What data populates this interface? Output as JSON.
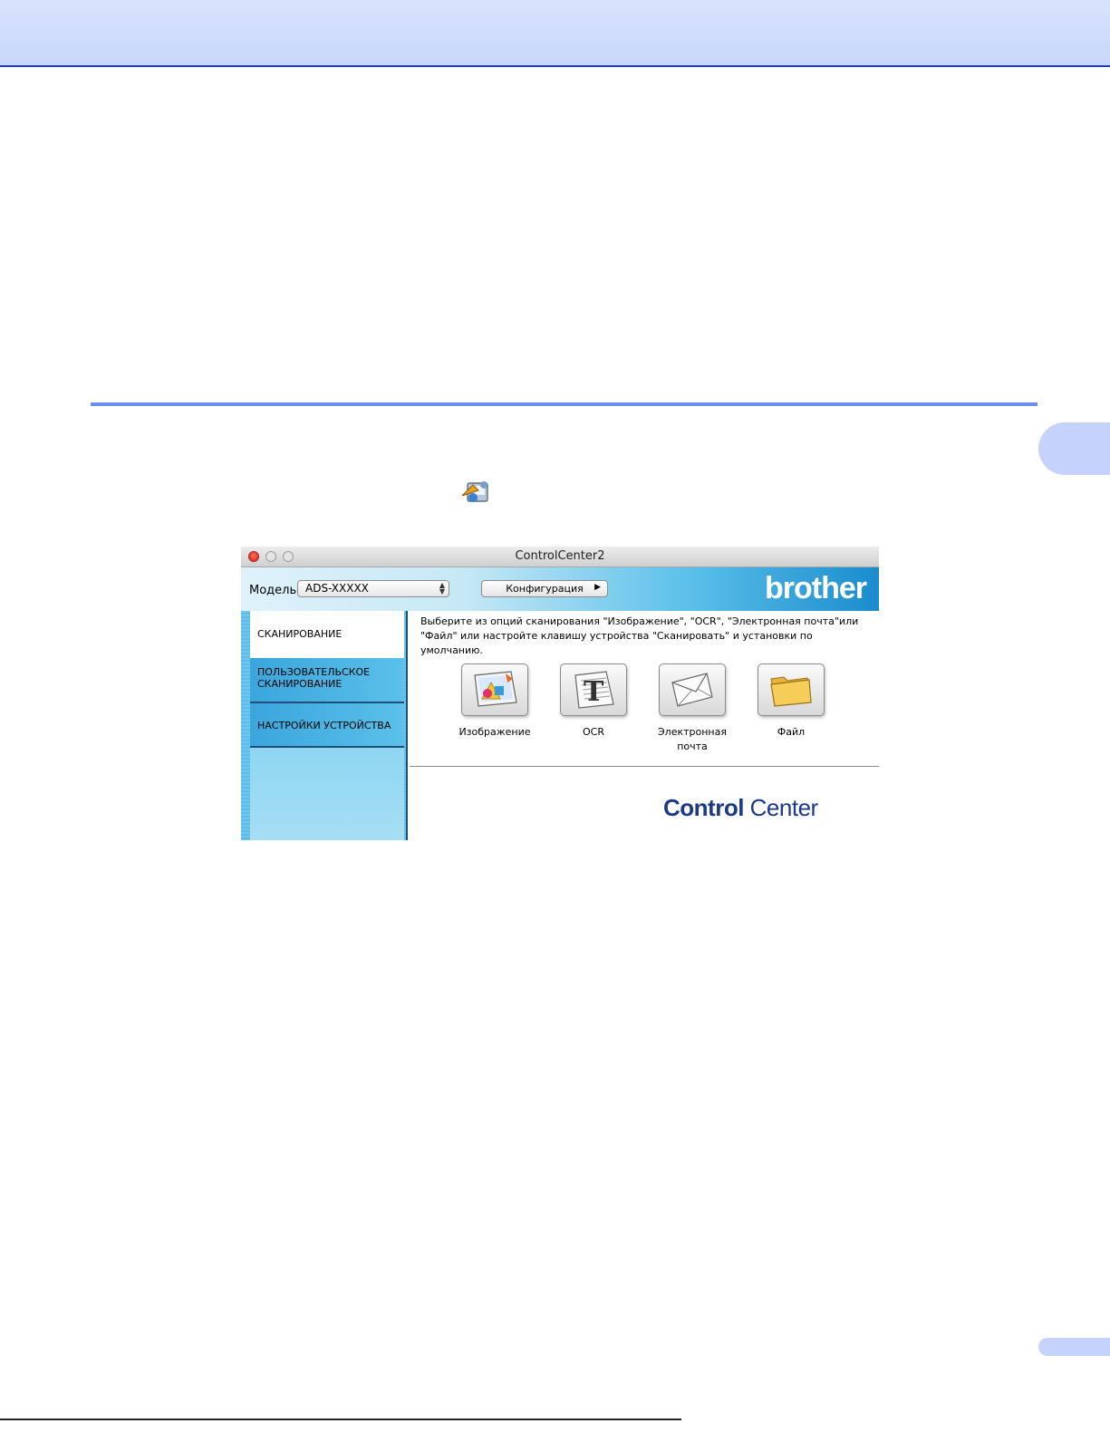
{
  "window": {
    "title": "ControlCenter2",
    "model_label": "Модель",
    "model_value": "ADS-XXXXX",
    "config_button": "Конфигурация",
    "brand": "brother"
  },
  "sidebar": {
    "items": [
      {
        "label": "СКАНИРОВАНИЕ",
        "active": true
      },
      {
        "label_line1": "ПОЛЬЗОВАТЕЛЬСКОЕ",
        "label_line2": "СКАНИРОВАНИЕ"
      },
      {
        "label": "НАСТРОЙКИ УСТРОЙСТВА"
      }
    ]
  },
  "main": {
    "description_line1": "Выберите из опций сканирования \"Изображение\", \"OCR\", \"Электронная почта\"или",
    "description_line2": "\"Файл\" или настройте клавишу устройства \"Сканировать\"  и установки по",
    "description_line3": "умолчанию.",
    "buttons": [
      {
        "label": "Изображение",
        "icon": "image-icon"
      },
      {
        "label": "OCR",
        "icon": "ocr-icon"
      },
      {
        "label_line1": "Электронная",
        "label_line2": "почта",
        "icon": "email-icon"
      },
      {
        "label": "Файл",
        "icon": "folder-icon"
      }
    ],
    "logo_bold": "Control",
    "logo_regular": " Center"
  }
}
